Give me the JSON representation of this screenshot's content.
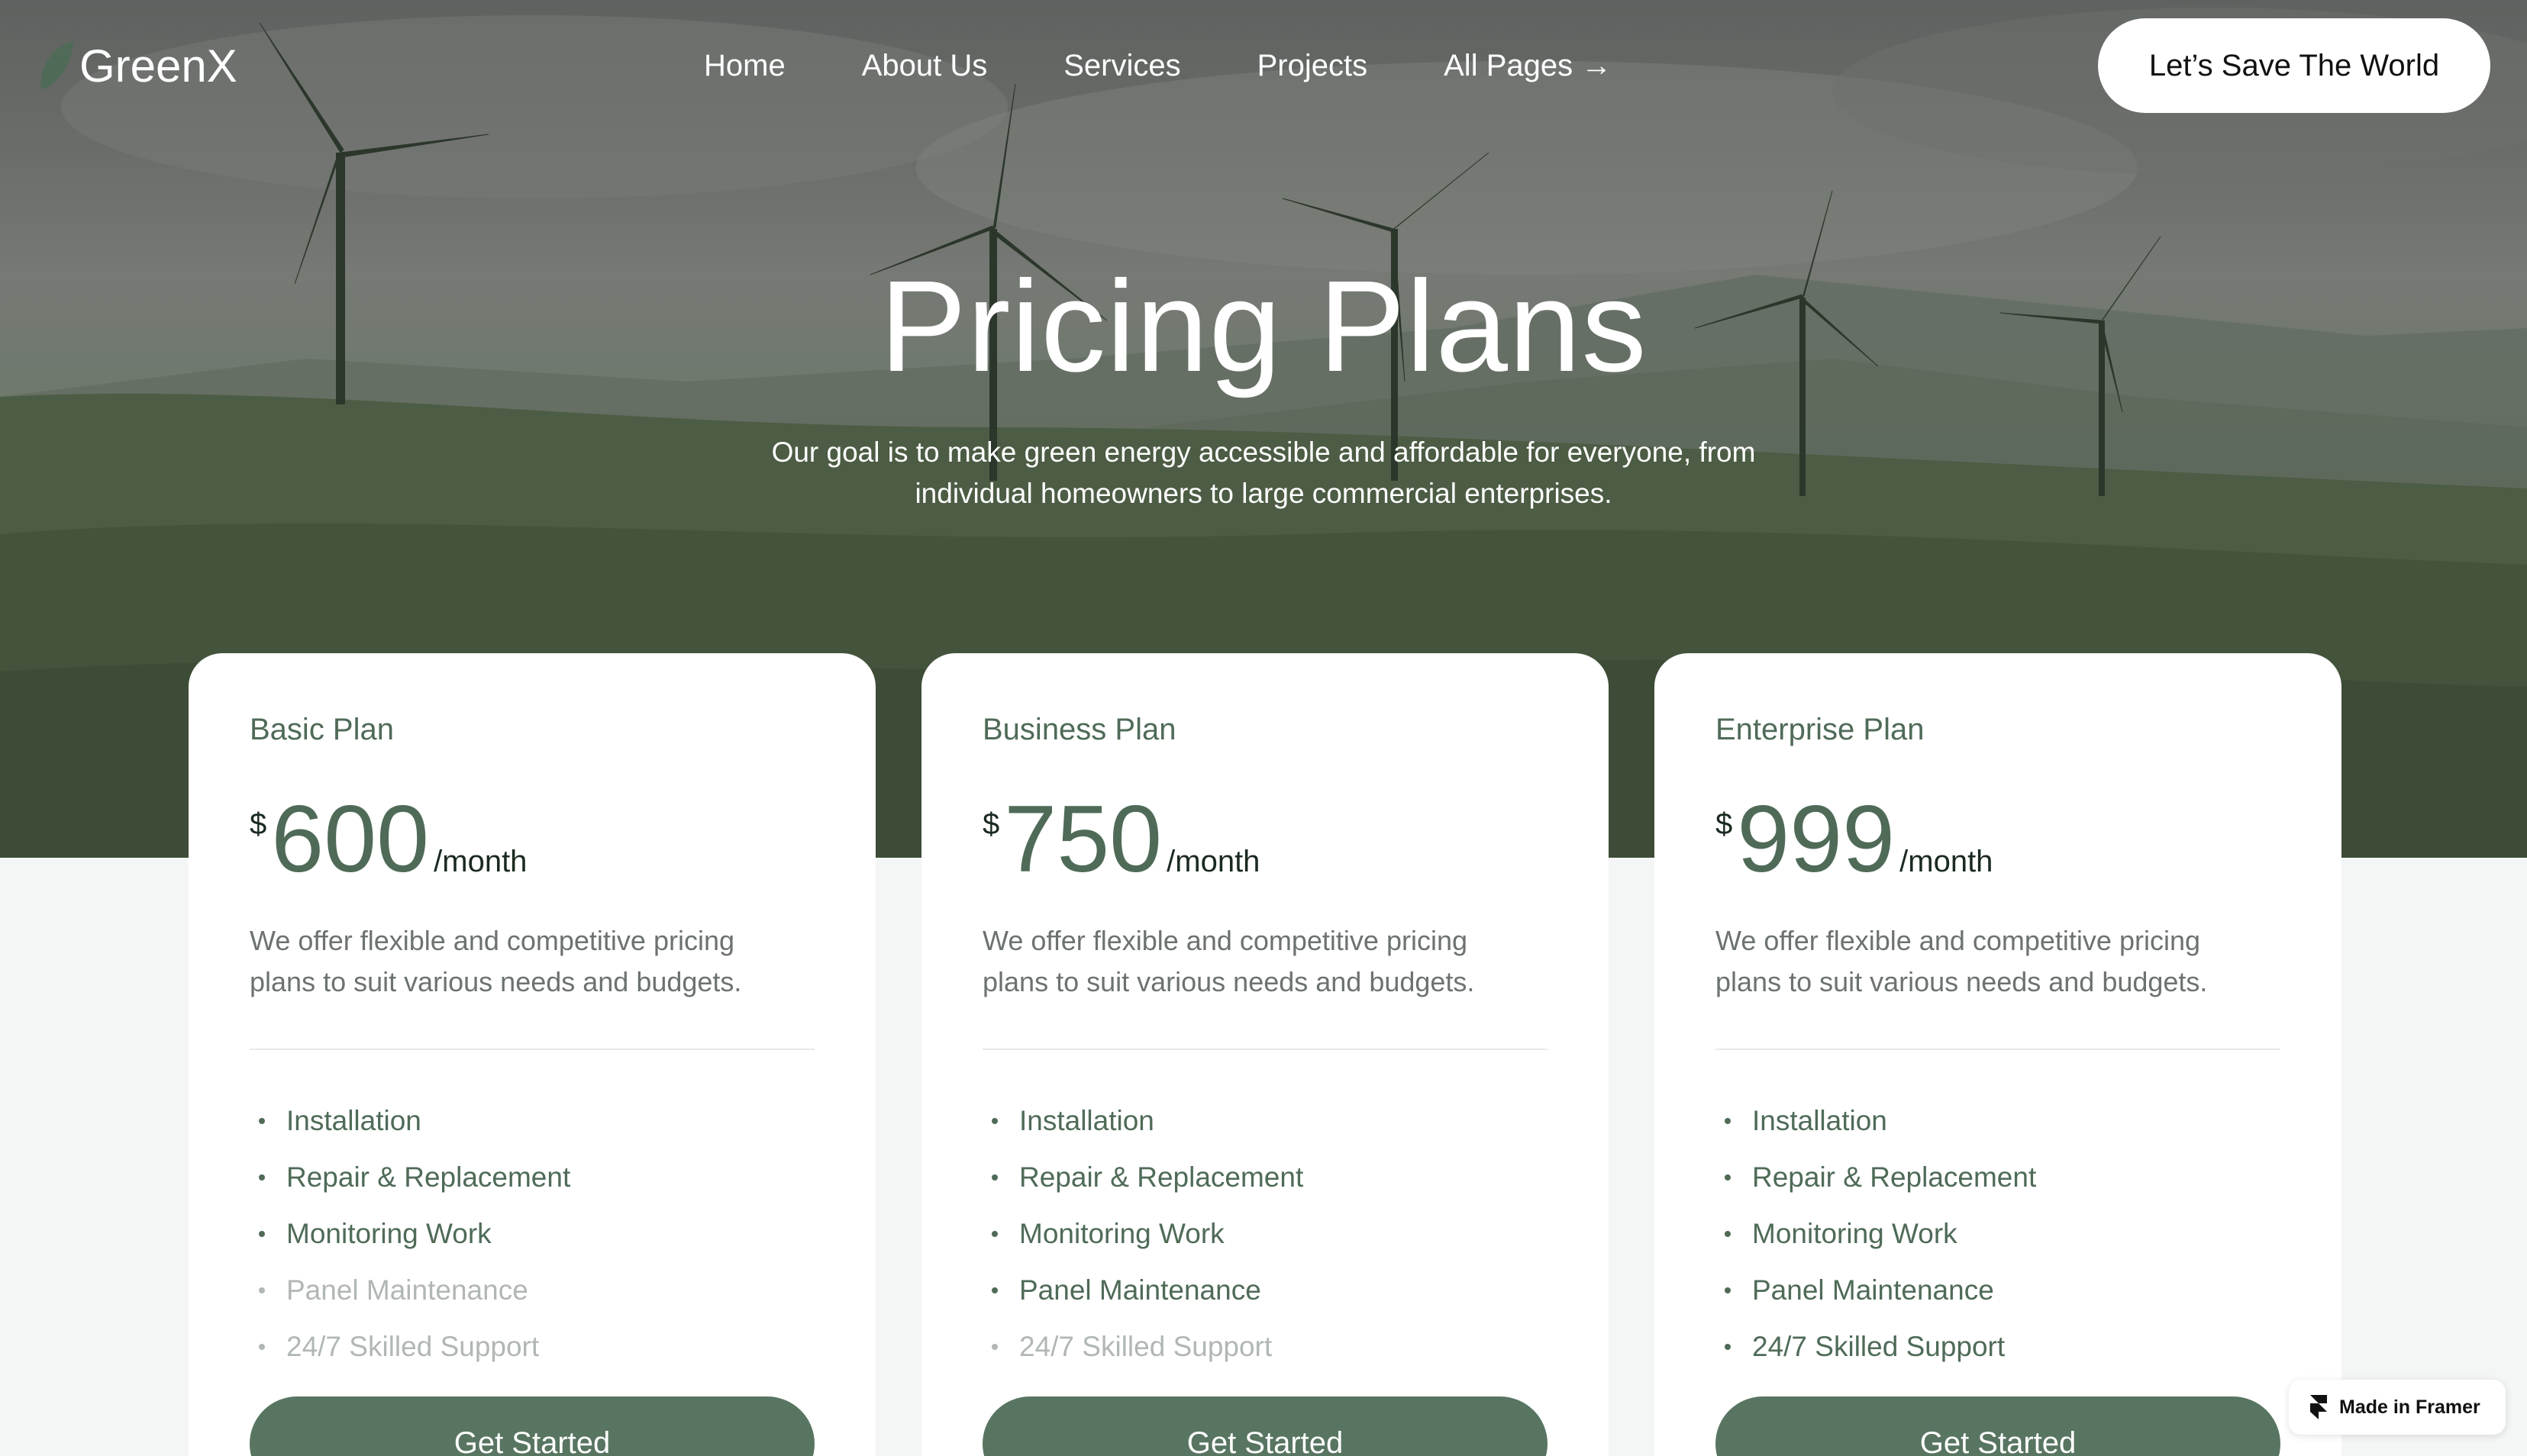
{
  "brand": {
    "name": "GreenX",
    "accent": "#587561",
    "text_accent": "#4f6b58"
  },
  "nav": {
    "items": [
      "Home",
      "About Us",
      "Services",
      "Projects",
      "All Pages →"
    ],
    "cta": "Let’s Save The World"
  },
  "hero": {
    "title": "Pricing Plans",
    "subtitle_line1": "Our goal is to make green energy accessible and affordable for everyone, from",
    "subtitle_line2": "individual homeowners to large commercial enterprises."
  },
  "plans": [
    {
      "name": "Basic Plan",
      "currency": "$",
      "amount": "600",
      "period": "/month",
      "description_line1": "We offer flexible and competitive pricing",
      "description_line2": "plans to suit various needs and budgets.",
      "features": [
        {
          "label": "Installation",
          "included": true
        },
        {
          "label": "Repair & Replacement",
          "included": true
        },
        {
          "label": "Monitoring Work",
          "included": true
        },
        {
          "label": "Panel Maintenance",
          "included": false
        },
        {
          "label": "24/7 Skilled Support",
          "included": false
        }
      ],
      "button": "Get Started"
    },
    {
      "name": "Business Plan",
      "currency": "$",
      "amount": "750",
      "period": "/month",
      "description_line1": "We offer flexible and competitive pricing",
      "description_line2": "plans to suit various needs and budgets.",
      "features": [
        {
          "label": "Installation",
          "included": true
        },
        {
          "label": "Repair & Replacement",
          "included": true
        },
        {
          "label": "Monitoring Work",
          "included": true
        },
        {
          "label": "Panel Maintenance",
          "included": true
        },
        {
          "label": "24/7 Skilled Support",
          "included": false
        }
      ],
      "button": "Get Started"
    },
    {
      "name": "Enterprise Plan",
      "currency": "$",
      "amount": "999",
      "period": "/month",
      "description_line1": "We offer flexible and competitive pricing",
      "description_line2": "plans to suit various needs and budgets.",
      "features": [
        {
          "label": "Installation",
          "included": true
        },
        {
          "label": "Repair & Replacement",
          "included": true
        },
        {
          "label": "Monitoring Work",
          "included": true
        },
        {
          "label": "Panel Maintenance",
          "included": true
        },
        {
          "label": "24/7 Skilled Support",
          "included": true
        }
      ],
      "button": "Get Started"
    }
  ],
  "badge": {
    "label": "Made in Framer",
    "icon": "framer-icon"
  }
}
